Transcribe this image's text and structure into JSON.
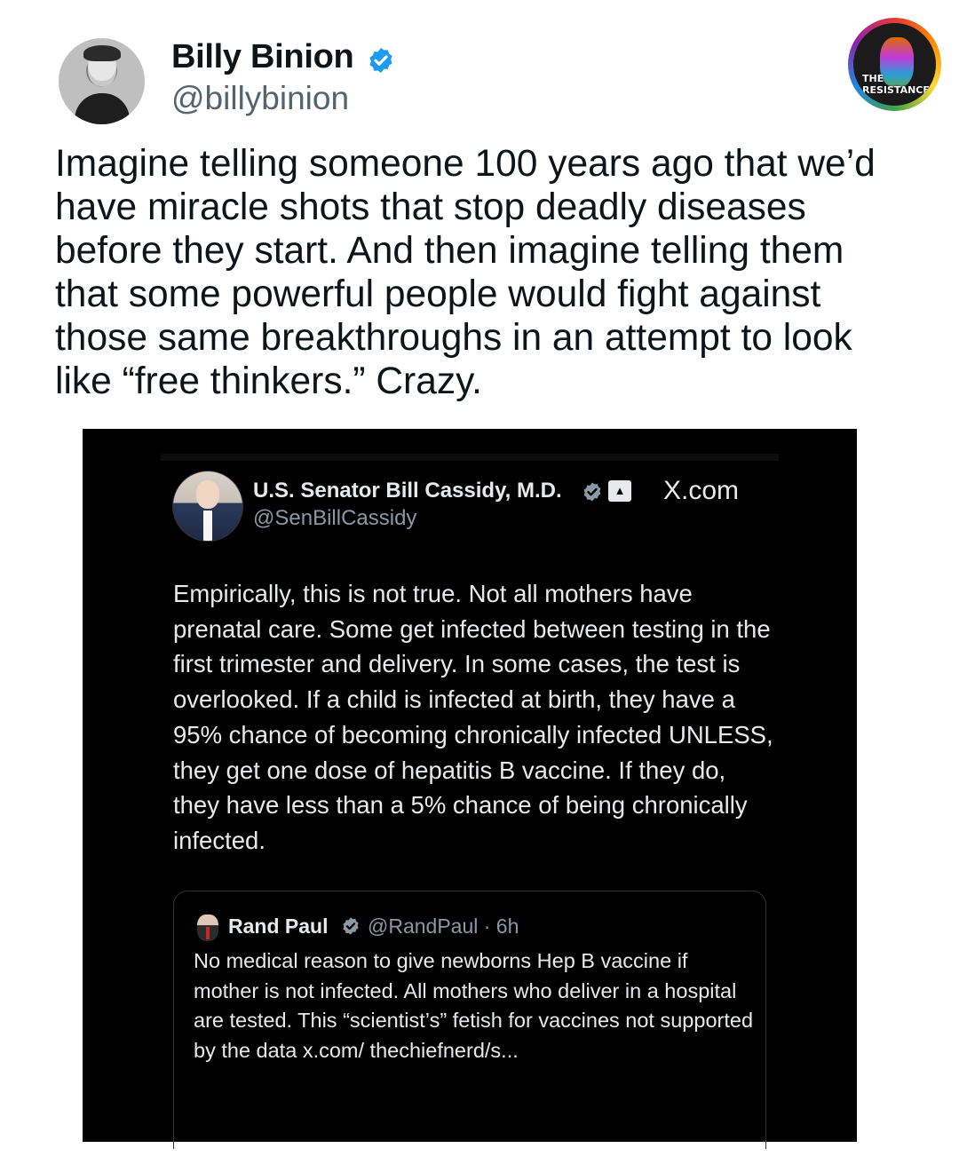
{
  "author": {
    "name": "Billy Binion",
    "handle": "@billybinion"
  },
  "tweet_text": "Imagine telling someone 100 years ago that we’d have miracle shots that stop deadly diseases before they start. And then imagine telling them that some powerful people would fight against those same breakthroughs in an attempt to look like “free thinkers.” Crazy.",
  "badge": {
    "line1": "THE",
    "line2": "RESISTANCE"
  },
  "embedded_post": {
    "name": "U.S. Senator Bill Cassidy, M.D.",
    "handle": "@SenBillCassidy",
    "source": "X.com",
    "text": "Empirically, this is not true. Not all mothers have prenatal care. Some get infected between testing in the first trimester and delivery. In some cases, the test is overlooked. If a child is infected at birth, they have a 95% chance of becoming chronically infected UNLESS, they get one dose of hepatitis B vaccine. If they do, they have less than a 5% chance of being chronically infected.",
    "quoted": {
      "name": "Rand Paul",
      "handle_time": "@RandPaul · 6h",
      "text": "No medical reason to give newborns Hep B vaccine if mother is not infected. All mothers who deliver in a hospital are tested. This “scientist’s” fetish for vaccines not supported by the data x.com/ thechiefnerd/s..."
    }
  },
  "colors": {
    "verified_blue": "#1d9bf0",
    "embed_background": "#000000",
    "secondary_text": "#536471"
  },
  "icons": [
    "verified-badge-icon",
    "government-building-icon",
    "x-logo"
  ]
}
